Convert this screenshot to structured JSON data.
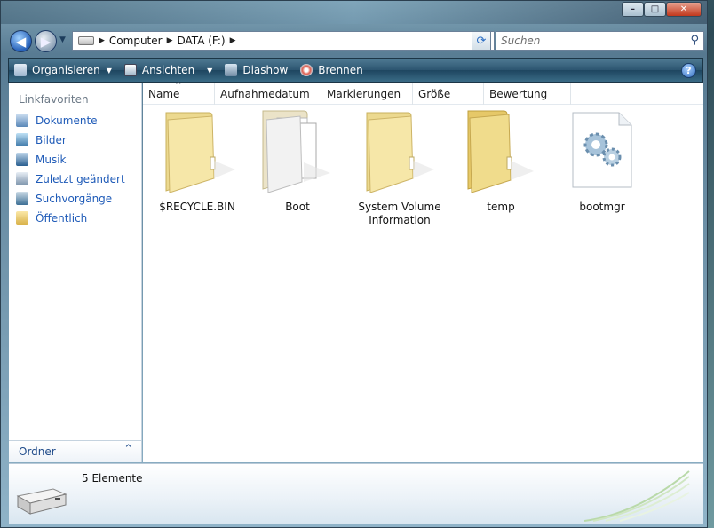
{
  "window": {
    "controls": {
      "minimize": "–",
      "maximize": "□",
      "close": "✕"
    }
  },
  "nav": {
    "back_icon": "back-arrow-icon",
    "forward_icon": "forward-arrow-icon",
    "breadcrumb": [
      "Computer",
      "DATA (F:)"
    ],
    "search_placeholder": "Suchen",
    "refresh_icon": "refresh-icon",
    "search_icon": "magnifier-icon"
  },
  "toolbar": {
    "organize": "Organisieren",
    "views": "Ansichten",
    "slideshow": "Diashow",
    "burn": "Brennen",
    "help": "?"
  },
  "sidebar": {
    "heading": "Linkfavoriten",
    "items": [
      {
        "label": "Dokumente",
        "icon": "documents-icon"
      },
      {
        "label": "Bilder",
        "icon": "pictures-icon"
      },
      {
        "label": "Musik",
        "icon": "music-icon"
      },
      {
        "label": "Zuletzt geändert",
        "icon": "recent-icon"
      },
      {
        "label": "Suchvorgänge",
        "icon": "searches-icon"
      },
      {
        "label": "Öffentlich",
        "icon": "public-folder-icon"
      }
    ],
    "folders_label": "Ordner",
    "folders_chevron": "⌃"
  },
  "columns": [
    "Name",
    "Aufnahmedatum",
    "Markierungen",
    "Größe",
    "Bewertung"
  ],
  "files": [
    {
      "name": "$RECYCLE.BIN",
      "icon": "folder-icon"
    },
    {
      "name": "Boot",
      "icon": "folder-with-documents-icon"
    },
    {
      "name": "System Volume Information",
      "icon": "folder-icon"
    },
    {
      "name": "temp",
      "icon": "open-folder-icon"
    },
    {
      "name": "bootmgr",
      "icon": "system-file-gears-icon"
    }
  ],
  "details": {
    "count": "5 Elemente",
    "icon": "drive-icon"
  },
  "colors": {
    "toolbar": "#2c5570",
    "link": "#1f5bb8",
    "folder": "#f3dc8b"
  }
}
